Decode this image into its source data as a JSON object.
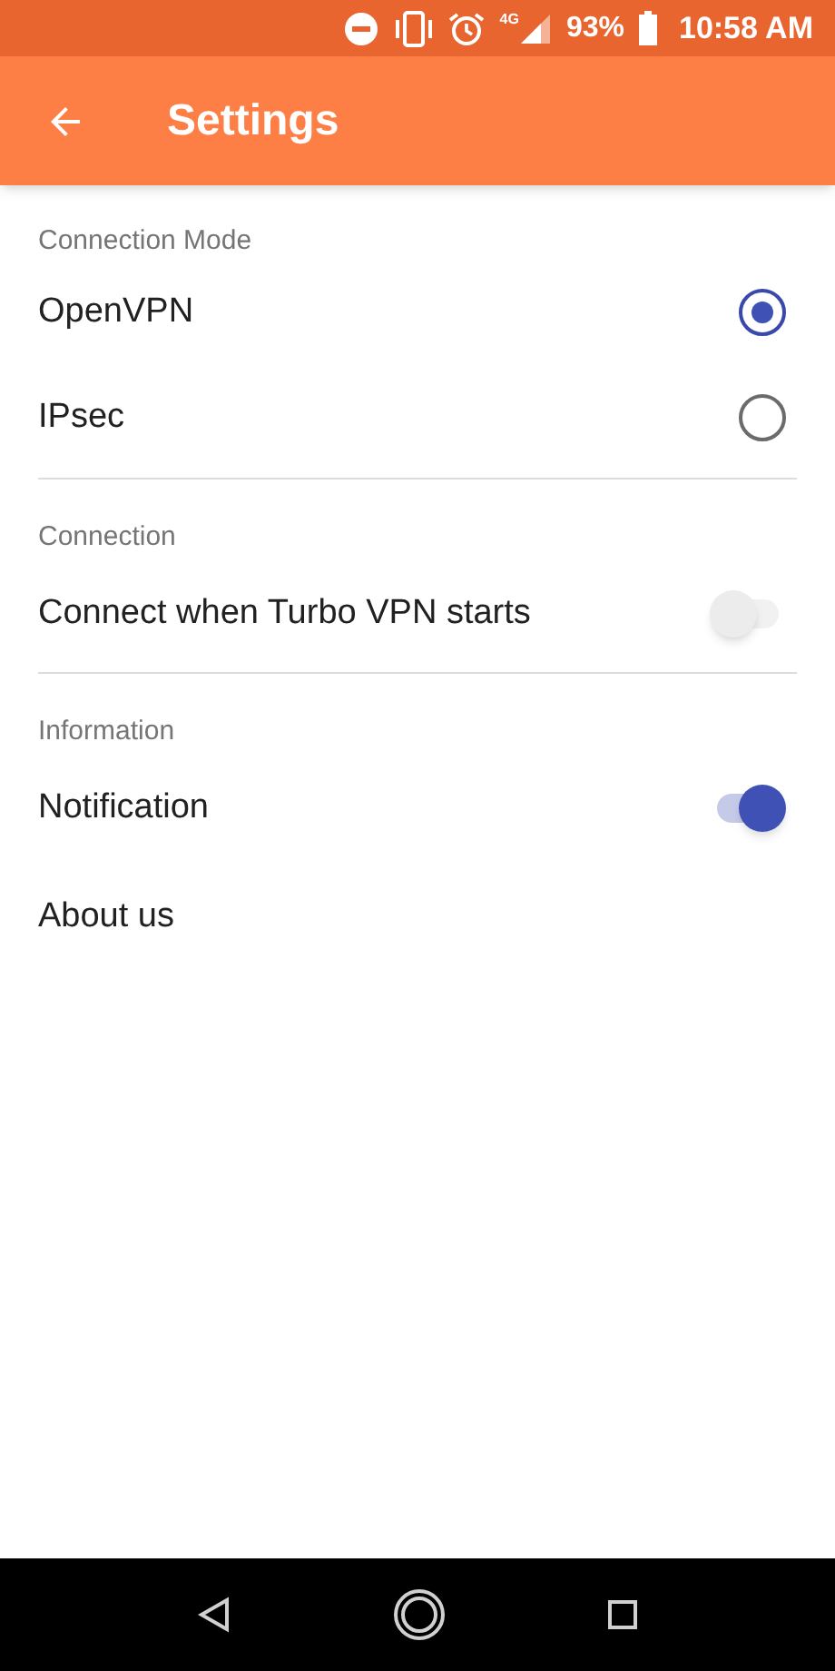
{
  "status_bar": {
    "network": "4G",
    "battery": "93%",
    "time": "10:58 AM"
  },
  "app_bar": {
    "title": "Settings"
  },
  "sections": [
    {
      "header": "Connection Mode",
      "items": [
        {
          "kind": "radio",
          "label": "OpenVPN",
          "selected": true
        },
        {
          "kind": "radio",
          "label": "IPsec",
          "selected": false
        }
      ]
    },
    {
      "header": "Connection",
      "items": [
        {
          "kind": "switch",
          "label": "Connect when Turbo VPN starts",
          "on": false
        }
      ]
    },
    {
      "header": "Information",
      "items": [
        {
          "kind": "switch",
          "label": "Notification",
          "on": true
        },
        {
          "kind": "plain",
          "label": "About us"
        }
      ]
    }
  ]
}
